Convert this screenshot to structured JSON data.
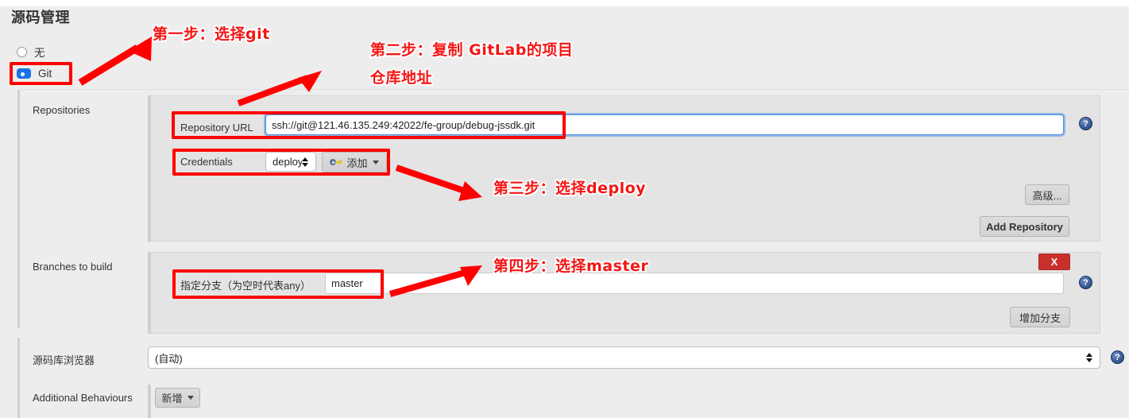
{
  "page": {
    "title": "源码管理"
  },
  "scm_options": [
    {
      "label": "无",
      "selected": false
    },
    {
      "label": "Git",
      "selected": true
    }
  ],
  "sections": {
    "repositories": {
      "label": "Repositories",
      "repository_url": {
        "label": "Repository URL",
        "value": "ssh://git@121.46.135.249:42022/fe-group/debug-jssdk.git",
        "placeholder": ""
      },
      "credentials": {
        "label": "Credentials",
        "selected": "deploy",
        "options": [
          "deploy"
        ],
        "add_button": "添加",
        "add_icon": "key-icon"
      },
      "advanced_button": "高级...",
      "add_repository_button": "Add Repository"
    },
    "branches": {
      "label": "Branches to build",
      "branch_specifier": {
        "label": "指定分支（为空时代表any）",
        "value": "master",
        "placeholder": ""
      },
      "delete_button": "X",
      "add_branch_button": "增加分支"
    },
    "browser": {
      "label": "源码库浏览器",
      "selected": "(自动)",
      "options": [
        "(自动)"
      ]
    },
    "additional": {
      "label": "Additional Behaviours",
      "add_button": "新增"
    }
  },
  "help_icon": "?",
  "annotations": [
    {
      "id": "step1",
      "text": "第一步：选择git"
    },
    {
      "id": "step2",
      "text": "第二步：复制 GitLab的项目"
    },
    {
      "id": "step2b",
      "text": "仓库地址"
    },
    {
      "id": "step3",
      "text": "第三步：选择deploy"
    },
    {
      "id": "step4",
      "text": "第四步：选择master"
    }
  ],
  "colors": {
    "annotation_red": "#f41616",
    "highlight_red": "#ff0000",
    "accent_blue": "#1a73e8",
    "delete_red": "#c9302c",
    "panel_bg": "#e4e4e4",
    "page_bg": "#ededed"
  }
}
